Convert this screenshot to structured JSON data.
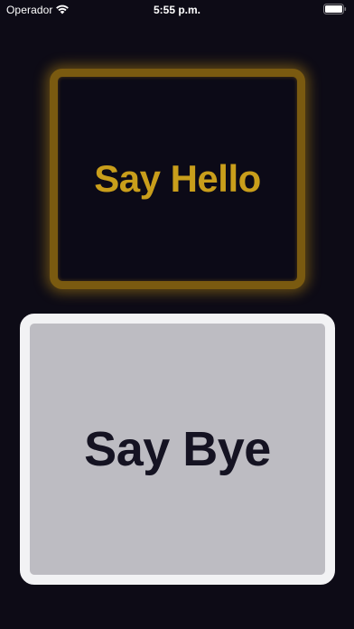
{
  "status_bar": {
    "carrier": "Operador",
    "time": "5:55 p.m.",
    "wifi_icon": "wifi-icon",
    "battery_icon": "battery-icon"
  },
  "buttons": {
    "hello_label": "Say Hello",
    "bye_label": "Say Bye"
  },
  "colors": {
    "background": "#0d0b16",
    "hello_text": "#c99e1b",
    "hello_border": "#7a5a10",
    "bye_fill": "#bdbcc2",
    "bye_border": "#f2f2f4",
    "bye_text": "#151322"
  }
}
